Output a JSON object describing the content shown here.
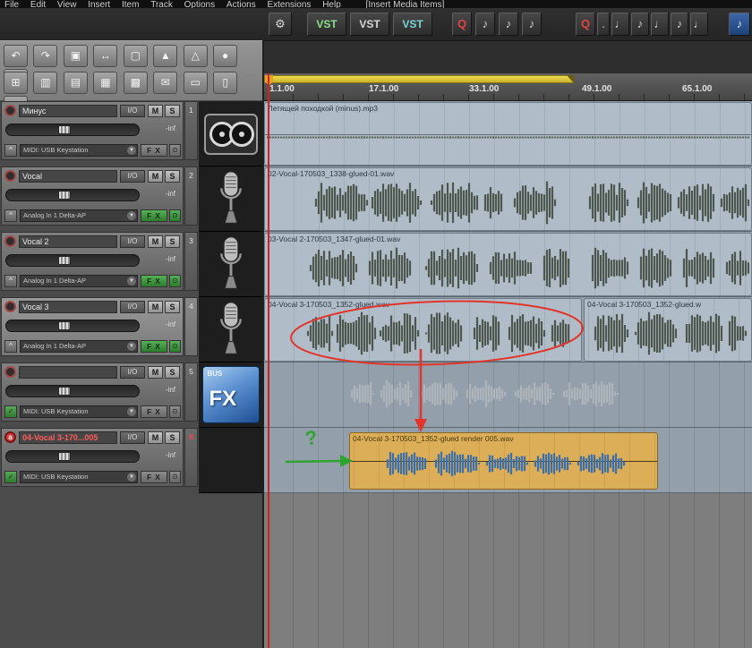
{
  "menu": {
    "items": [
      "File",
      "Edit",
      "View",
      "Insert",
      "Item",
      "Track",
      "Options",
      "Actions",
      "Extensions",
      "Help",
      "[Insert Media Items]"
    ]
  },
  "toolbar": {
    "vst": [
      "VST",
      "VST",
      "VST"
    ],
    "q": "Q",
    "dot": ".",
    "note": "♪",
    "note2": "♩"
  },
  "icons": {
    "gear": "⚙",
    "dropdown": "▼",
    "power": "⊙"
  },
  "lt": {
    "r1": [
      "↶",
      "↷",
      "▣",
      "↔",
      "▢",
      "▲",
      "△",
      "●",
      "S+"
    ],
    "r2": [
      "⊞",
      "▥",
      "▤",
      "▦",
      "▩",
      "✉",
      "▭",
      "▯",
      "M+"
    ]
  },
  "labels": {
    "io": "I/O",
    "mute": "M",
    "solo": "S",
    "fx": "FX"
  },
  "tracks": [
    {
      "number": "1",
      "name": "Минус",
      "volume": "-inf",
      "input": "MIDI: USB Keystation",
      "env_icon": "^",
      "arm_label": ""
    },
    {
      "number": "2",
      "name": "Vocal",
      "volume": "-inf",
      "input": "Analog In 1 Delta-AP",
      "env_icon": "^",
      "arm_label": ""
    },
    {
      "number": "3",
      "name": "Vocal 2",
      "volume": "-inf",
      "input": "Analog In 1 Delta-AP",
      "env_icon": "^",
      "arm_label": ""
    },
    {
      "number": "4",
      "name": "Vocal 3",
      "volume": "-inf",
      "input": "Analog In 1 Delta-AP",
      "env_icon": "^",
      "arm_label": ""
    },
    {
      "number": "5",
      "name": "",
      "volume": "-inf",
      "input": "MIDI: USB Keystation",
      "env_icon": "✓",
      "arm_label": ""
    },
    {
      "number": "8",
      "name": "04-Vocal 3-170...005",
      "volume": "-inf",
      "input": "MIDI: USB Keystation",
      "env_icon": "✓",
      "arm_label": "a"
    }
  ],
  "iconcol": {
    "bus": "BUS",
    "fx": "FX"
  },
  "ruler": {
    "labels": [
      "1.1.00",
      "17.1.00",
      "33.1.00",
      "49.1.00",
      "65.1.00"
    ]
  },
  "items": [
    {
      "title": "Летящей походкой (minus).mp3"
    },
    {
      "title": "02-Vocal-170503_1338-glued-01.wav"
    },
    {
      "title": "03-Vocal 2-170503_1347-glued-01.wav"
    },
    {
      "title": "04-Vocal 3-170503_1352-glued.wav"
    },
    {
      "title": "04-Vocal 3-170503_1352-glued.w"
    },
    {
      "title": "04-Vocal 3-170503_1352-glued render 005.wav"
    }
  ],
  "waveforms": {
    "minus": [
      [
        0.0,
        1.0,
        0.05
      ]
    ],
    "v1": [
      [
        0.1,
        0.21,
        0.95
      ],
      [
        0.215,
        0.32,
        0.9
      ],
      [
        0.34,
        0.44,
        0.98
      ],
      [
        0.45,
        0.49,
        0.7
      ],
      [
        0.51,
        0.6,
        0.95
      ],
      [
        0.665,
        0.75,
        0.9
      ],
      [
        0.765,
        0.84,
        0.95
      ],
      [
        0.85,
        0.93,
        0.9
      ],
      [
        0.94,
        1.0,
        0.85
      ]
    ],
    "v2": [
      [
        0.09,
        0.19,
        0.9
      ],
      [
        0.21,
        0.3,
        0.95
      ],
      [
        0.33,
        0.44,
        0.9
      ],
      [
        0.46,
        0.55,
        0.85
      ],
      [
        0.57,
        0.63,
        0.9
      ],
      [
        0.67,
        0.75,
        0.95
      ],
      [
        0.77,
        0.84,
        0.9
      ],
      [
        0.86,
        0.93,
        0.95
      ],
      [
        0.95,
        1.0,
        0.8
      ]
    ],
    "v3a": [
      [
        0.13,
        0.21,
        0.85
      ],
      [
        0.22,
        0.35,
        0.95
      ],
      [
        0.36,
        0.49,
        0.9
      ],
      [
        0.51,
        0.63,
        0.95
      ],
      [
        0.66,
        0.75,
        0.85
      ],
      [
        0.77,
        0.89,
        0.95
      ],
      [
        0.91,
        0.97,
        0.8
      ]
    ],
    "v3b": [
      [
        0.04,
        0.26,
        0.9
      ],
      [
        0.3,
        0.56,
        0.95
      ],
      [
        0.6,
        0.84,
        0.9
      ],
      [
        0.87,
        0.98,
        0.8
      ]
    ],
    "ghost": [
      [
        0.0,
        0.08,
        0.5
      ],
      [
        0.1,
        0.22,
        0.6
      ],
      [
        0.25,
        0.38,
        0.55
      ],
      [
        0.41,
        0.55,
        0.6
      ],
      [
        0.58,
        0.72,
        0.5
      ],
      [
        0.75,
        0.95,
        0.55
      ]
    ],
    "render": [
      [
        0.11,
        0.25,
        0.6
      ],
      [
        0.27,
        0.42,
        0.65
      ],
      [
        0.44,
        0.58,
        0.6
      ],
      [
        0.6,
        0.72,
        0.65
      ],
      [
        0.74,
        0.9,
        0.55
      ]
    ]
  },
  "annotations": {
    "question": "?"
  }
}
